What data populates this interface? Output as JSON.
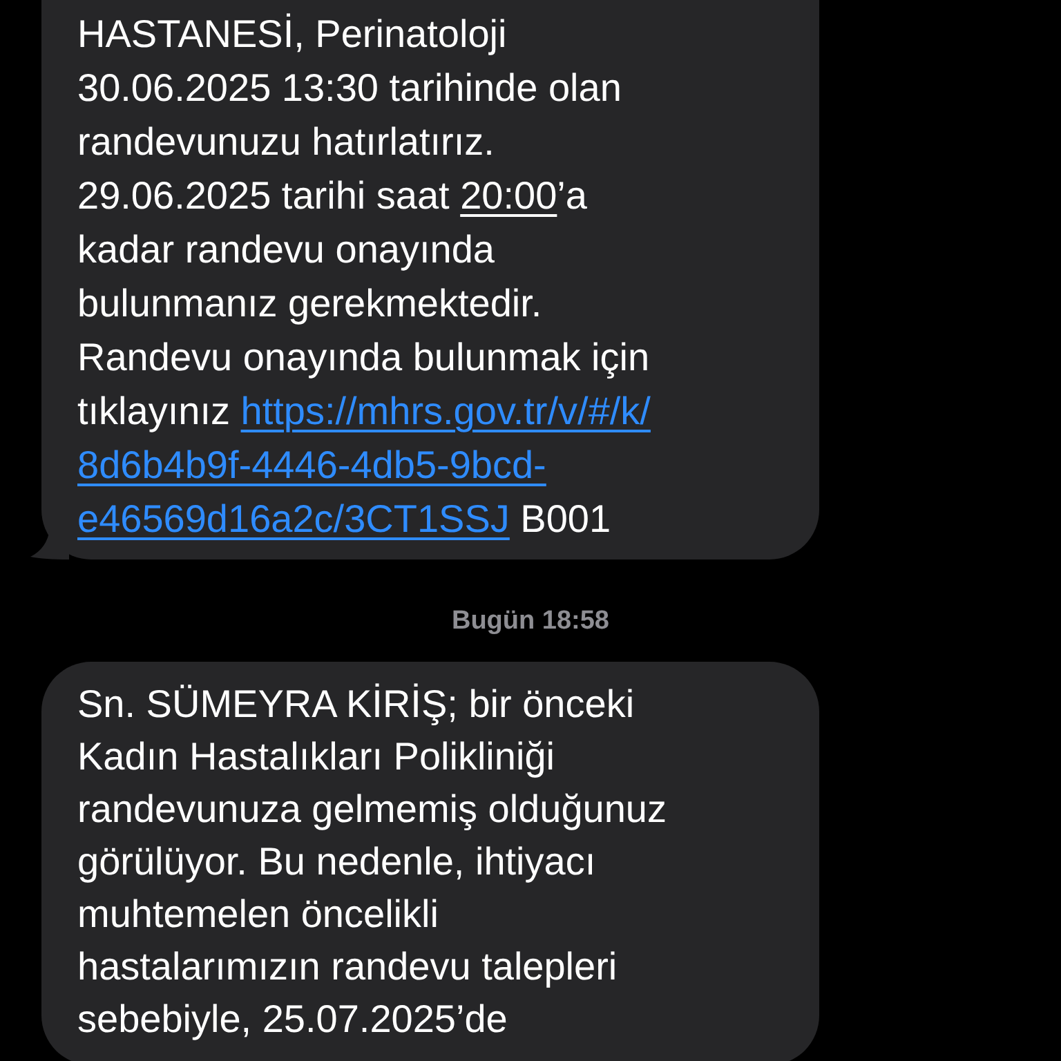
{
  "messages": [
    {
      "lines": [
        [
          {
            "kind": "plain",
            "text": "HASTANESİ, Perinatoloji"
          }
        ],
        [
          {
            "kind": "plain",
            "text": "30.06.2025 13:30 tarihinde olan"
          }
        ],
        [
          {
            "kind": "plain",
            "text": "randevunuzu hatırlatırız."
          }
        ],
        [
          {
            "kind": "plain",
            "text": "29.06.2025 tarihi saat "
          },
          {
            "kind": "detected",
            "text": "20:00"
          },
          {
            "kind": "plain",
            "text": "’a"
          }
        ],
        [
          {
            "kind": "plain",
            "text": "kadar randevu onayında"
          }
        ],
        [
          {
            "kind": "plain",
            "text": "bulunmanız gerekmektedir."
          }
        ],
        [
          {
            "kind": "plain",
            "text": "Randevu onayında bulunmak için"
          }
        ],
        [
          {
            "kind": "plain",
            "text": "tıklayınız "
          },
          {
            "kind": "link",
            "text": "https://mhrs.gov.tr/v/#/k/"
          }
        ],
        [
          {
            "kind": "link",
            "text": "8d6b4b9f-4446-4db5-9bcd-"
          }
        ],
        [
          {
            "kind": "link",
            "text": "e46569d16a2c/3CT1SSJ"
          },
          {
            "kind": "plain",
            "text": " B001"
          }
        ]
      ],
      "tail": true
    },
    {
      "timestamp": "Bugün 18:58",
      "lines": [
        [
          {
            "kind": "plain",
            "text": "Sn. SÜMEYRA KİRİŞ; bir önceki"
          }
        ],
        [
          {
            "kind": "plain",
            "text": "Kadın Hastalıkları Polikliniği"
          }
        ],
        [
          {
            "kind": "plain",
            "text": "randevunuza gelmemiş olduğunuz"
          }
        ],
        [
          {
            "kind": "plain",
            "text": "görülüyor. Bu nedenle, ihtiyacı"
          }
        ],
        [
          {
            "kind": "plain",
            "text": "muhtemelen öncelikli"
          }
        ],
        [
          {
            "kind": "plain",
            "text": "hastalarımızın randevu talepleri"
          }
        ],
        [
          {
            "kind": "plain",
            "text": "sebebiyle, 25.07.2025’de"
          }
        ]
      ],
      "tail": false
    }
  ]
}
